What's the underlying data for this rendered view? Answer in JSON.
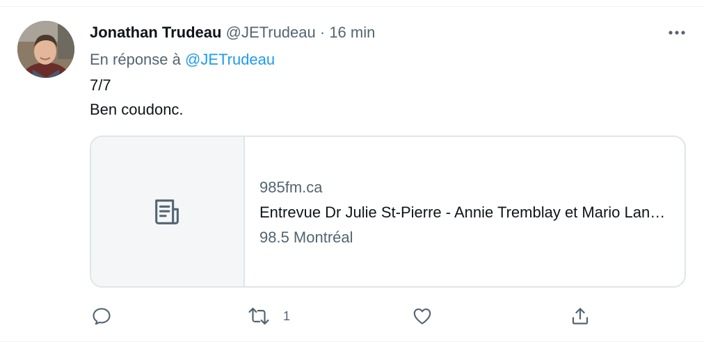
{
  "tweet": {
    "author_name": "Jonathan Trudeau",
    "handle": "@JETrudeau",
    "separator": " · ",
    "time": "16 min",
    "reply_prefix": "En réponse à",
    "reply_to": "@JETrudeau",
    "text_line1": "7/7",
    "text_line2": "Ben coudonc."
  },
  "card": {
    "domain": "985fm.ca",
    "title": "Entrevue Dr Julie St-Pierre - Annie Tremblay et Mario Langlois",
    "description": "98.5 Montréal",
    "thumbnail_icon": "article-icon"
  },
  "actions": {
    "reply_icon": "reply-icon",
    "retweet_icon": "retweet-icon",
    "retweet_count": "1",
    "like_icon": "heart-icon",
    "share_icon": "share-icon",
    "more_icon": "more-horizontal-icon"
  },
  "colors": {
    "text_primary": "#0f1419",
    "text_secondary": "#536471",
    "link": "#1d9bf0",
    "border": "#dfe5e8",
    "card_thumb_bg": "#f4f6f7"
  }
}
